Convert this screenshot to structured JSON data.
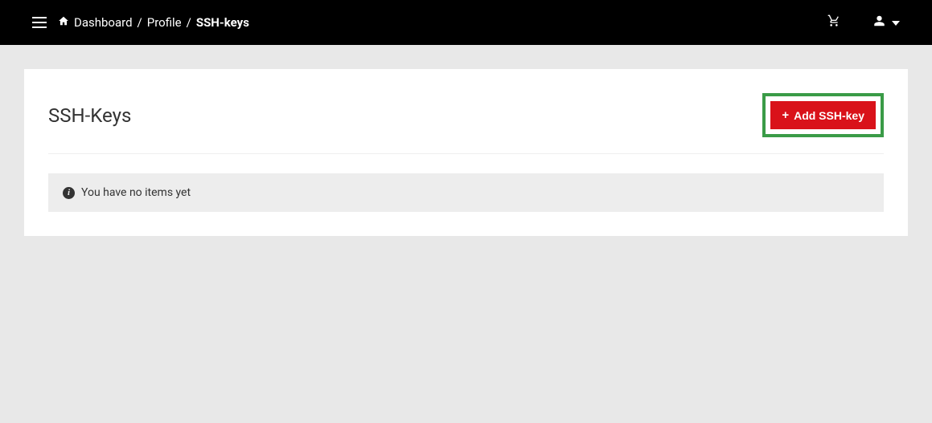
{
  "breadcrumb": {
    "items": [
      {
        "label": "Dashboard"
      },
      {
        "label": "Profile"
      },
      {
        "label": "SSH-keys"
      }
    ]
  },
  "page": {
    "title": "SSH-Keys"
  },
  "actions": {
    "add_label": "Add SSH-key"
  },
  "alert": {
    "message": "You have no items yet"
  }
}
